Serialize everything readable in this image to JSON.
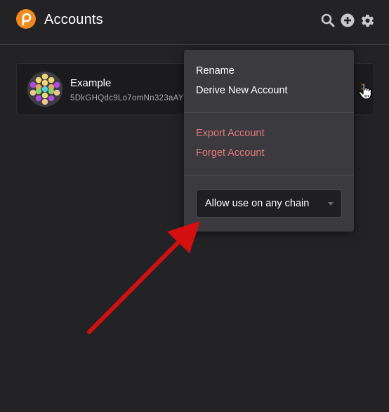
{
  "header": {
    "title": "Accounts",
    "logo_icon": "polkadot-p-logo-icon",
    "icons": [
      "search-icon",
      "add-circle-icon",
      "settings-gear-icon"
    ]
  },
  "account": {
    "name": "Example",
    "address": "5DkGHQdc9Lo7omNn323aAY",
    "avatar_icon": "identicon-avatar",
    "menu_icon": "vertical-dots-menu-icon"
  },
  "menu": {
    "rename_label": "Rename",
    "derive_label": "Derive New Account",
    "export_label": "Export Account",
    "forget_label": "Forget Account",
    "chain_select": {
      "selected": "Allow use on any chain"
    }
  },
  "colors": {
    "background": "#232326",
    "accent": "#f08a1d",
    "danger": "#e07a7a",
    "menu_background": "#3a3a3f",
    "annotation_arrow": "#d40f0f"
  }
}
